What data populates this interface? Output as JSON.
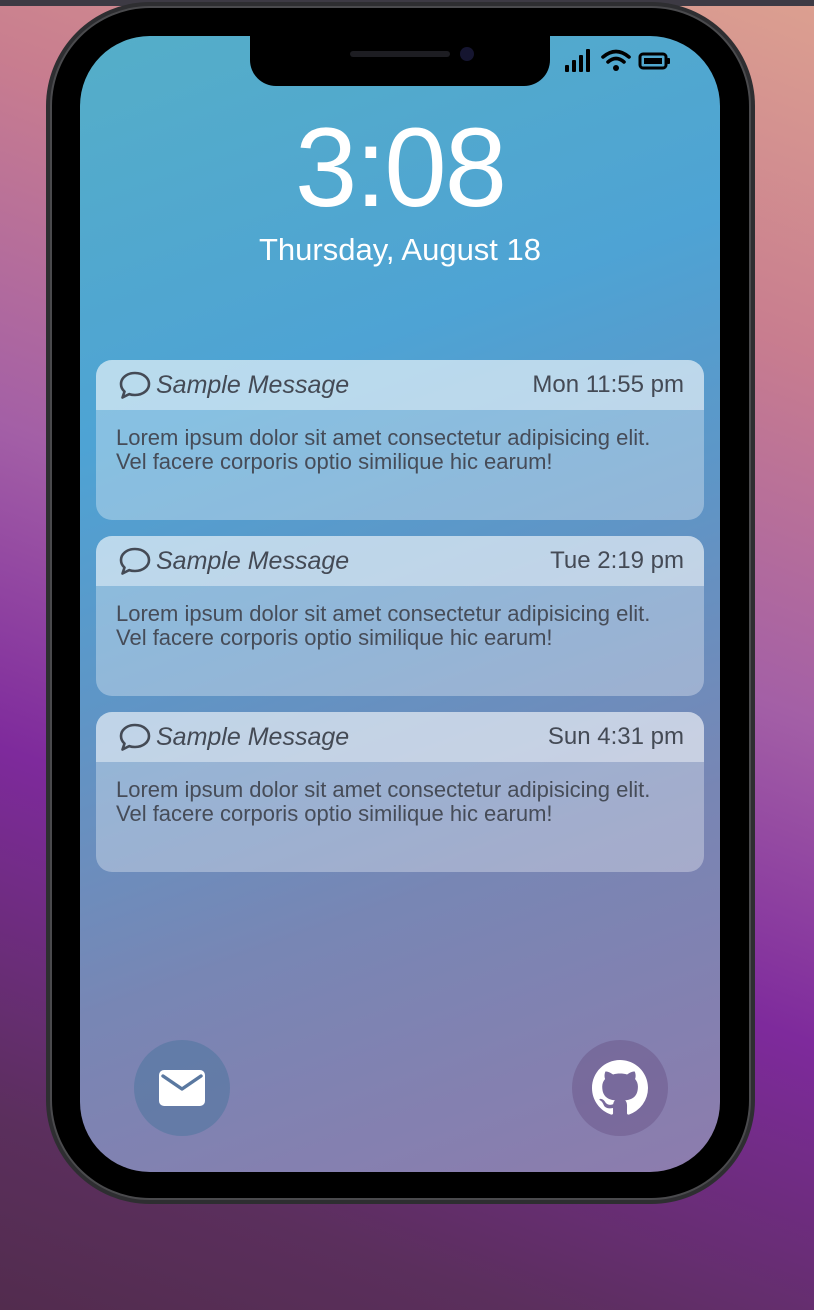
{
  "lock_screen": {
    "time": "3:08",
    "date": "Thursday, August 18"
  },
  "notifications": [
    {
      "icon": "message-bubble-icon",
      "app_name": "Sample Message",
      "time": "Mon 11:55 pm",
      "body": "Lorem ipsum dolor sit amet consectetur adipisicing elit. Vel facere corporis optio similique hic earum!"
    },
    {
      "icon": "message-bubble-icon",
      "app_name": "Sample Message",
      "time": "Tue 2:19 pm",
      "body": "Lorem ipsum dolor sit amet consectetur adipisicing elit. Vel facere corporis optio similique hic earum!"
    },
    {
      "icon": "message-bubble-icon",
      "app_name": "Sample Message",
      "time": "Sun 4:31 pm",
      "body": "Lorem ipsum dolor sit amet consectetur adipisicing elit. Vel facere corporis optio similique hic earum!"
    }
  ],
  "status_bar": {
    "icons": [
      "signal-icon",
      "wifi-icon",
      "battery-icon"
    ]
  },
  "quick_actions": [
    {
      "icon": "mail-icon"
    },
    {
      "icon": "github-icon"
    }
  ],
  "colors": {
    "text_on_screen": "#ffffff",
    "notification_text": "#444a55"
  }
}
